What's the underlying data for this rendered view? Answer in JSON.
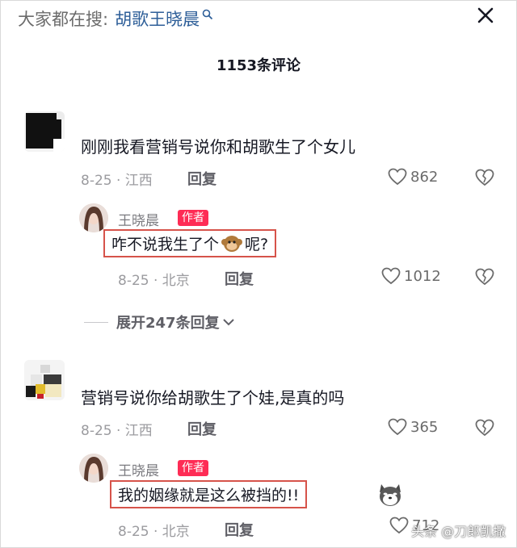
{
  "search": {
    "prefix": "大家都在搜:",
    "query": "胡歌王晓晨"
  },
  "comment_count": "1153条评论",
  "comments": [
    {
      "text": "刚刚我看营销号说你和胡歌生了个女儿",
      "date_location": "8-25 · 江西",
      "reply_label": "回复",
      "likes": "862",
      "reply": {
        "name": "王晓晨",
        "badge": "作者",
        "text_before": "咋不说我生了个",
        "emoji": "monkey",
        "text_after": "呢?",
        "date_location": "8-25 · 北京",
        "reply_label": "回复",
        "likes": "1012"
      }
    },
    {
      "text": "营销号说你给胡歌生了个娃,是真的吗",
      "date_location": "8-25 · 江西",
      "reply_label": "回复",
      "likes": "365",
      "reply": {
        "name": "王晓晨",
        "badge": "作者",
        "text": "我的姻缘就是这么被挡的!!",
        "emoji": "doge",
        "date_location": "8-25 · 北京",
        "reply_label": "回复",
        "likes": "712"
      }
    }
  ],
  "expand_replies": "展开247条回复",
  "watermark": "头条 @刀郎凯撒",
  "colors": {
    "accent_red": "#fe2c55",
    "link_blue": "#2d5e98",
    "highlight_box": "#d6534a"
  }
}
